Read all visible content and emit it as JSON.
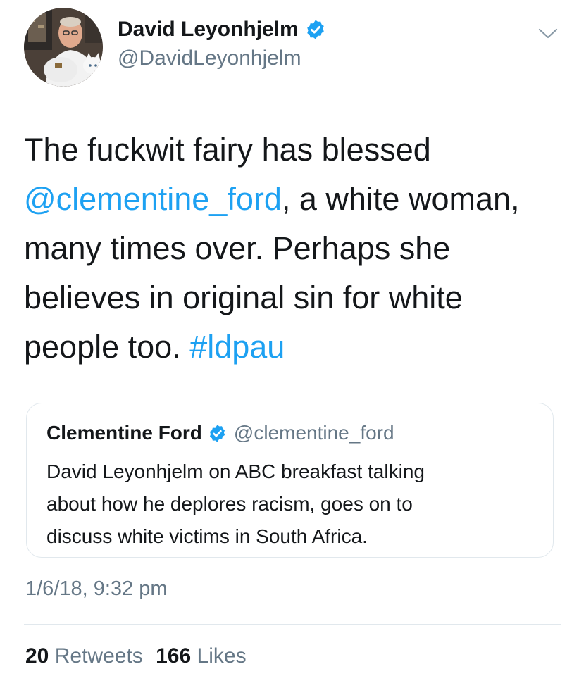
{
  "author": {
    "name": "David Leyonhjelm",
    "handle": "@DavidLeyonhjelm",
    "verified": true,
    "avatar": "avatar-photo"
  },
  "tweet": {
    "lines": [
      [
        "The fuckwit fairy has blessed"
      ],
      [
        "@clementine_ford",
        ", a white woman,"
      ],
      [
        "many times over. Perhaps she"
      ],
      [
        "believes in original sin for white"
      ],
      [
        "people too. ",
        "#ldpau"
      ]
    ]
  },
  "quoted": {
    "name": "Clementine Ford",
    "handle": "@clementine_ford",
    "verified": true,
    "lines": [
      "David Leyonhjelm on ABC breakfast talking",
      "about how he deplores racism, goes on to",
      "discuss white victims in South Africa."
    ]
  },
  "timestamp": "1/6/18, 9:32 pm",
  "stats": {
    "retweets_count": "20",
    "retweets_label": "Retweets",
    "likes_count": "166",
    "likes_label": "Likes"
  },
  "colors": {
    "link": "#1da1f2",
    "text": "#14171a",
    "secondary": "#657786",
    "border": "#e1e8ed",
    "verified": "#1da1f2"
  },
  "icons": [
    "verified-badge-icon",
    "chevron-down-icon"
  ]
}
